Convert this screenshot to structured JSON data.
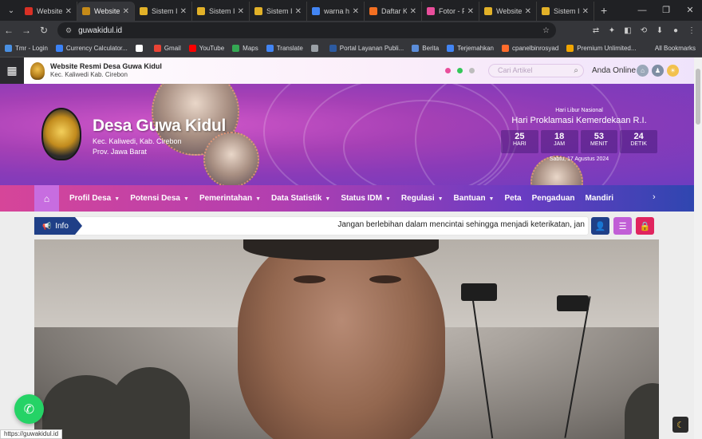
{
  "browser": {
    "tabs": [
      {
        "title": "Website",
        "color": "#d93025"
      },
      {
        "title": "Website",
        "color": "#c58a18"
      },
      {
        "title": "Sistem In",
        "color": "#e2b128"
      },
      {
        "title": "Sistem In",
        "color": "#e2b128"
      },
      {
        "title": "Sistem In",
        "color": "#e2b128"
      },
      {
        "title": "warna ht",
        "color": "#4285f4"
      },
      {
        "title": "Daftar K",
        "color": "#f36f21"
      },
      {
        "title": "Fotor - F",
        "color": "#e94e9b"
      },
      {
        "title": "Website",
        "color": "#e2b128"
      },
      {
        "title": "Sistem In",
        "color": "#e2b128"
      }
    ],
    "new_tab": "+",
    "url": "guwakidul.id",
    "bookmarks": [
      {
        "label": "Tmr - Login",
        "color": "#4a90e2"
      },
      {
        "label": "Currency Calculator...",
        "color": "#3b82f6"
      },
      {
        "label": "",
        "color": "#ffffff"
      },
      {
        "label": "Gmail",
        "color": "#ea4335"
      },
      {
        "label": "YouTube",
        "color": "#ff0000"
      },
      {
        "label": "Maps",
        "color": "#34a853"
      },
      {
        "label": "Translate",
        "color": "#4285f4"
      },
      {
        "label": "",
        "color": "#9aa0a6"
      },
      {
        "label": "Portal Layanan Publi...",
        "color": "#2c5aa0"
      },
      {
        "label": "Berita",
        "color": "#5b8dd9"
      },
      {
        "label": "Terjemahkan",
        "color": "#4285f4"
      },
      {
        "label": "cpanelbinrosyad",
        "color": "#ff6c2c"
      },
      {
        "label": "Premium Unlimited...",
        "color": "#f0a500"
      }
    ],
    "all_bookmarks": "All Bookmarks",
    "status_url": "https://guwakidul.id"
  },
  "site": {
    "top_title": "Website Resmi Desa Guwa Kidul",
    "top_subtitle": "Kec. Kaliwedi Kab. Cirebon",
    "search_placeholder": "Cari Artikel",
    "online_label": "Anda Online",
    "village_name": "Desa Guwa Kidul",
    "district": "Kec. Kaliwedi, Kab. Cirebon",
    "province": "Prov. Jawa Barat",
    "holiday": {
      "label": "Hari Libur Nasional",
      "name": "Hari Proklamasi Kemerdekaan R.I.",
      "countdown": [
        {
          "value": "25",
          "unit": "HARI"
        },
        {
          "value": "18",
          "unit": "JAM"
        },
        {
          "value": "53",
          "unit": "MENIT"
        },
        {
          "value": "24",
          "unit": "DETIK"
        }
      ],
      "date": "Sabtu, 17 Agustus 2024"
    },
    "menu": [
      "Profil Desa",
      "Potensi Desa",
      "Pemerintahan",
      "Data Statistik",
      "Status IDM",
      "Regulasi",
      "Bantuan",
      "Peta",
      "Pengaduan",
      "Mandiri"
    ],
    "menu_has_caret": [
      true,
      true,
      true,
      true,
      true,
      true,
      true,
      false,
      false,
      false
    ],
    "info_label": "Info",
    "ticker_text": "Jangan berlebihan dalam mencintai sehingga menjadi keterikatan, jan",
    "colors": {
      "accent_purple": "#b23fb0",
      "accent_pink": "#d64599",
      "info_blue": "#1f3f87",
      "whatsapp_green": "#25d366"
    }
  }
}
